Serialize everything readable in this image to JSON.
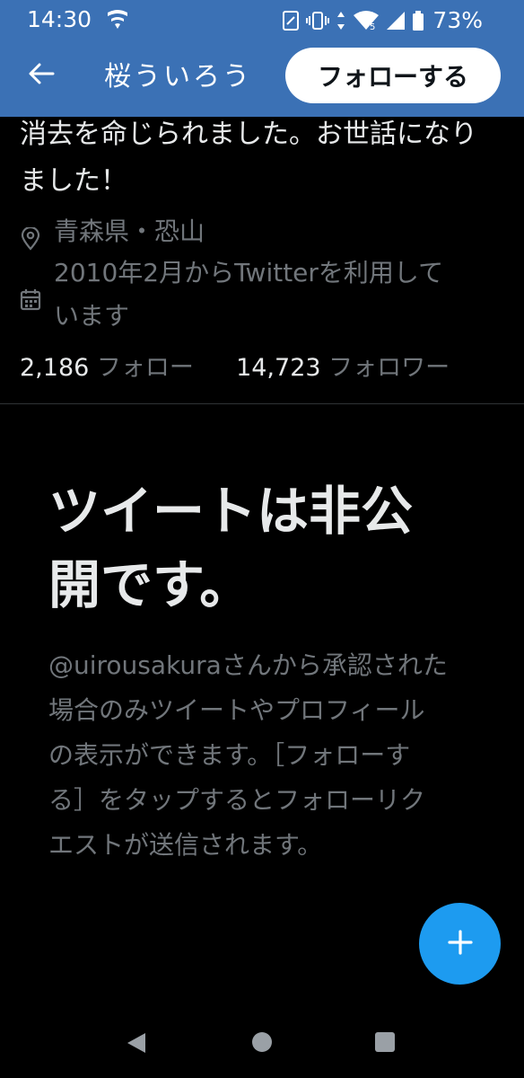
{
  "status_bar": {
    "time": "14:30",
    "battery_percent": "73%",
    "icons": [
      "shield-wifi-icon",
      "nfc-icon",
      "vibrate-icon",
      "data-arrows-icon",
      "wifi-icon",
      "signal-icon",
      "battery-icon"
    ]
  },
  "header": {
    "back_icon": "arrow-left-icon",
    "title": "桜ういろう",
    "follow_label": "フォローする"
  },
  "profile": {
    "bio_line1": "消去を命じられました。お世話になり",
    "bio_line2": "ました！",
    "location": "青森県・恐山",
    "joined_line1": "2010年2月からTwitterを利用して",
    "joined_line2": "います",
    "following_count": "2,186",
    "following_label": "フォロー",
    "followers_count": "14,723",
    "followers_label": "フォロワー"
  },
  "private_notice": {
    "heading_line1": "ツイートは非公",
    "heading_line2": "開です。",
    "desc_line1": "@uirousakuraさんから承認された",
    "desc_line2": "場合のみツイートやプロフィール",
    "desc_line3": "の表示ができます。［フォローす",
    "desc_line4": "る］をタップするとフォローリク",
    "desc_line5": "エストが送信されます。"
  },
  "fab": {
    "icon": "plus-icon"
  },
  "colors": {
    "header_bg": "#3b71b5",
    "accent": "#1d9bf0",
    "background": "#000000",
    "secondary_text": "#71767b"
  }
}
